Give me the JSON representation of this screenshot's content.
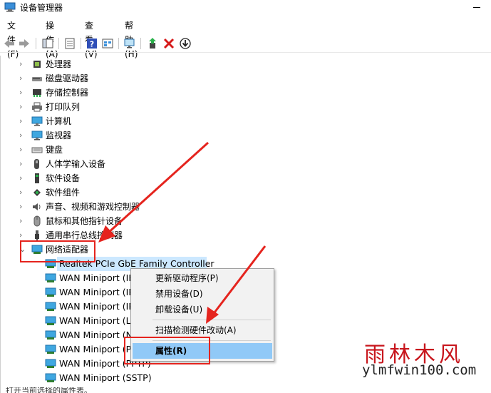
{
  "window": {
    "title": "设备管理器"
  },
  "menu": [
    {
      "label": "文件(F)"
    },
    {
      "label": "操作(A)"
    },
    {
      "label": "查看(V)"
    },
    {
      "label": "帮助(H)"
    }
  ],
  "tree": {
    "categories": [
      {
        "label": "处理器",
        "icon": "cpu-icon"
      },
      {
        "label": "磁盘驱动器",
        "icon": "disk-drive-icon"
      },
      {
        "label": "存储控制器",
        "icon": "storage-controller-icon"
      },
      {
        "label": "打印队列",
        "icon": "printer-icon"
      },
      {
        "label": "计算机",
        "icon": "computer-icon"
      },
      {
        "label": "监视器",
        "icon": "monitor-icon"
      },
      {
        "label": "键盘",
        "icon": "keyboard-icon"
      },
      {
        "label": "人体学输入设备",
        "icon": "hid-icon"
      },
      {
        "label": "软件设备",
        "icon": "software-device-icon"
      },
      {
        "label": "软件组件",
        "icon": "software-component-icon"
      },
      {
        "label": "声音、视频和游戏控制器",
        "icon": "speaker-icon"
      },
      {
        "label": "鼠标和其他指针设备",
        "icon": "mouse-icon"
      },
      {
        "label": "通用串行总线控制器",
        "icon": "usb-icon"
      },
      {
        "label": "网络适配器",
        "icon": "network-adapter-icon",
        "expanded": true
      }
    ],
    "network_children": [
      {
        "label": "Realtek PCIe GbE Family Controller",
        "selected": true
      },
      {
        "label": "WAN Miniport (IK"
      },
      {
        "label": "WAN Miniport (IP"
      },
      {
        "label": "WAN Miniport (IP"
      },
      {
        "label": "WAN Miniport (L"
      },
      {
        "label": "WAN Miniport (N"
      },
      {
        "label": "WAN Miniport (P"
      },
      {
        "label": "WAN Miniport (PPTP)"
      },
      {
        "label": "WAN Miniport (SSTP)"
      }
    ]
  },
  "context_menu": {
    "items": [
      {
        "label": "更新驱动程序(P)"
      },
      {
        "label": "禁用设备(D)"
      },
      {
        "label": "卸载设备(U)"
      },
      {
        "label": "扫描检测硬件改动(A)"
      },
      {
        "label": "属性(R)",
        "highlighted": true
      }
    ]
  },
  "watermark": {
    "brand": "雨林木风",
    "url": "ylmfwin100.com"
  },
  "status": {
    "text": "打开当前选择的属性表。"
  },
  "colors": {
    "annotation_red": "#e5241e",
    "selection": "#cce8ff",
    "menu_highlight": "#91c9f7"
  }
}
